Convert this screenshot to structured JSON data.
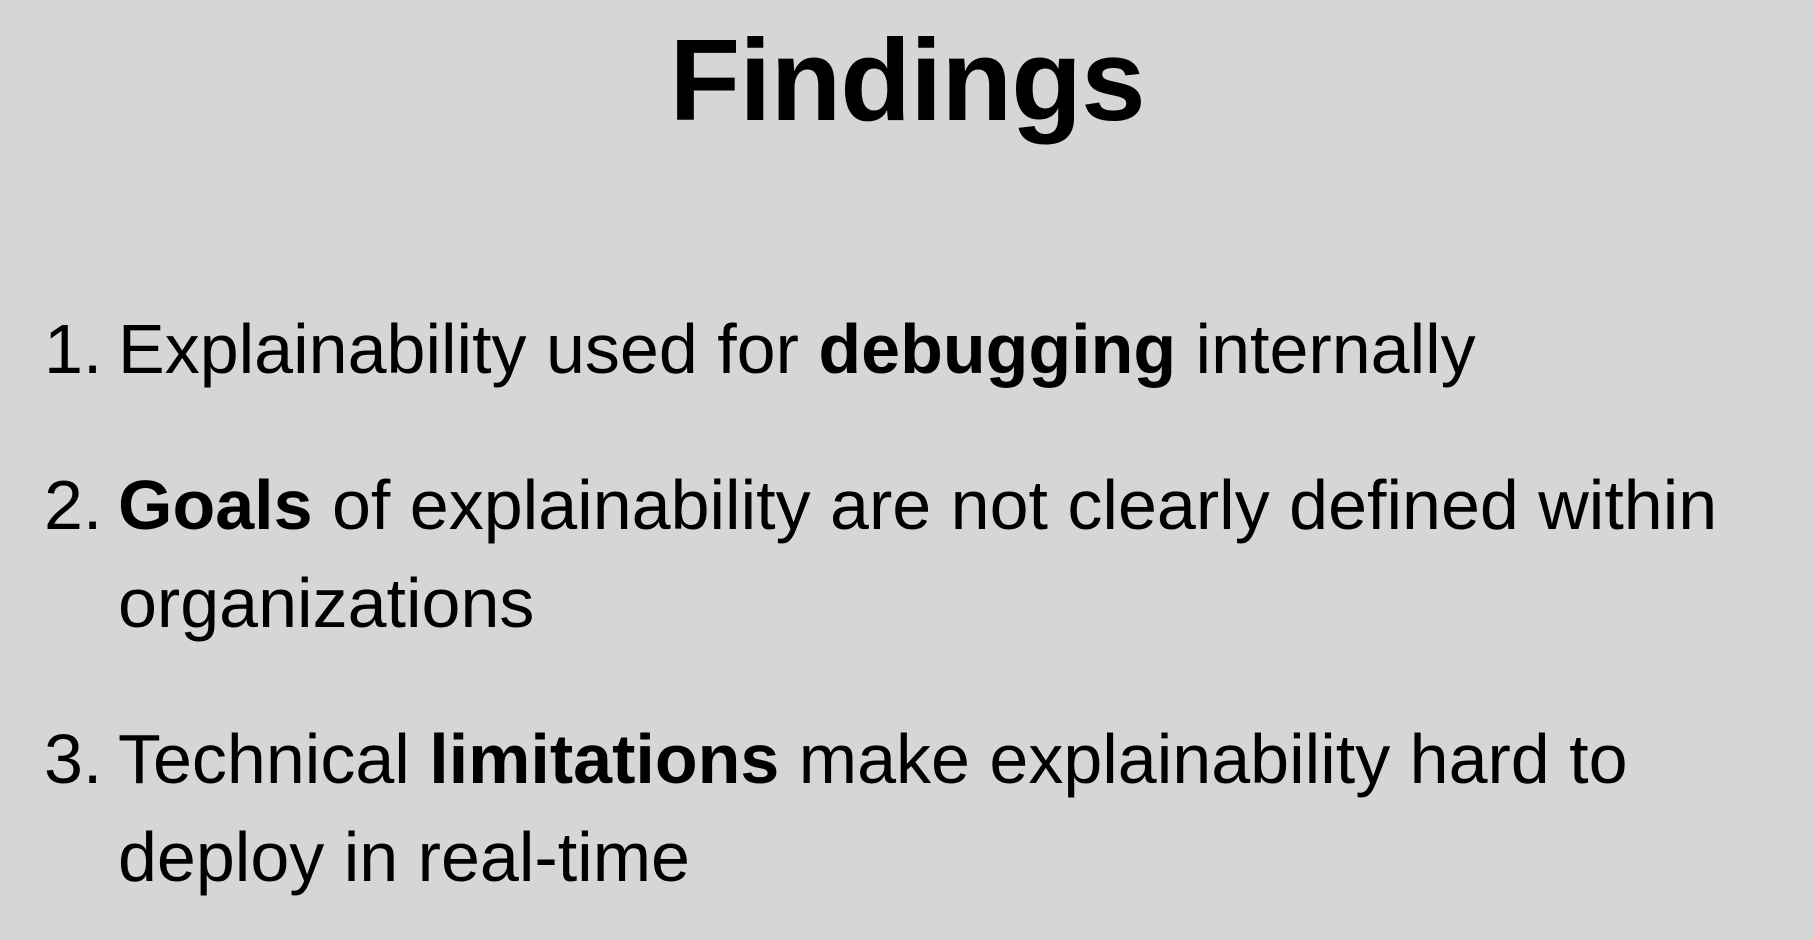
{
  "slide": {
    "title": "Findings",
    "findings": [
      {
        "number": "1.",
        "before": "Explainability used for ",
        "bold": "debugging",
        "after": " internally"
      },
      {
        "number": "2.",
        "before": "",
        "bold": "Goals",
        "after": " of explainability are not clearly defined within organizations"
      },
      {
        "number": "3.",
        "before": "Technical ",
        "bold": "limitations",
        "after": " make explainability hard to deploy in real-time"
      }
    ]
  },
  "colors": {
    "background": "#d6d6d6",
    "text": "#000000"
  }
}
